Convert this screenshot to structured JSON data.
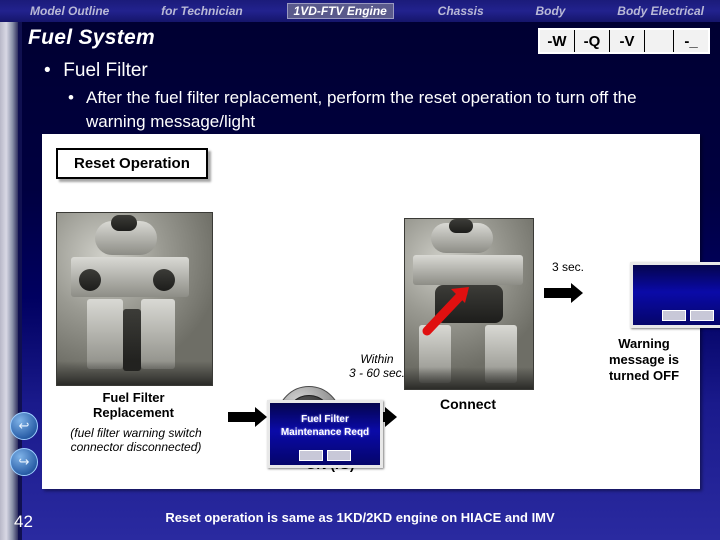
{
  "topnav": {
    "items": [
      {
        "label": "Model Outline",
        "active": false
      },
      {
        "label": "for Technician",
        "active": false
      },
      {
        "label": "1VD-FTV Engine",
        "active": true
      },
      {
        "label": "Chassis",
        "active": false
      },
      {
        "label": "Body",
        "active": false
      },
      {
        "label": "Body Electrical",
        "active": false
      }
    ]
  },
  "header": {
    "title": "Fuel System",
    "tabs": [
      "-W",
      "-Q",
      "-V",
      "",
      "-_"
    ]
  },
  "bullets": {
    "level1": "Fuel Filter",
    "level2": "After the fuel filter replacement, perform the reset operation to turn off the warning message/light"
  },
  "panel": {
    "box_title": "Reset Operation",
    "step1_caption_bold": "Fuel Filter\nReplacement",
    "step1_caption_italic": "(fuel filter warning switch connector disconnected)",
    "step2_label": "ON (IG)",
    "timing_within": "Within\n3 - 60 sec.",
    "step3_label": "Connect",
    "timing_3sec": "3 sec.",
    "step4_caption": "Warning\nmessage is\nturned OFF",
    "screen_warning": "Fuel Filter\nMaintenance Reqd"
  },
  "footer": {
    "caption": "Reset operation is same as 1KD/2KD engine on HIACE and IMV",
    "page_number": "42"
  },
  "nav_buttons": [
    {
      "icon": "back-arrow-icon",
      "glyph": "↩"
    },
    {
      "icon": "forward-arrow-icon",
      "glyph": "↪"
    }
  ],
  "colors": {
    "accent_blue": "#0b0b8b",
    "nav_active_bg": "#5a5a8c",
    "panel_bg": "#ffffff",
    "arrow_red": "#e01010"
  }
}
